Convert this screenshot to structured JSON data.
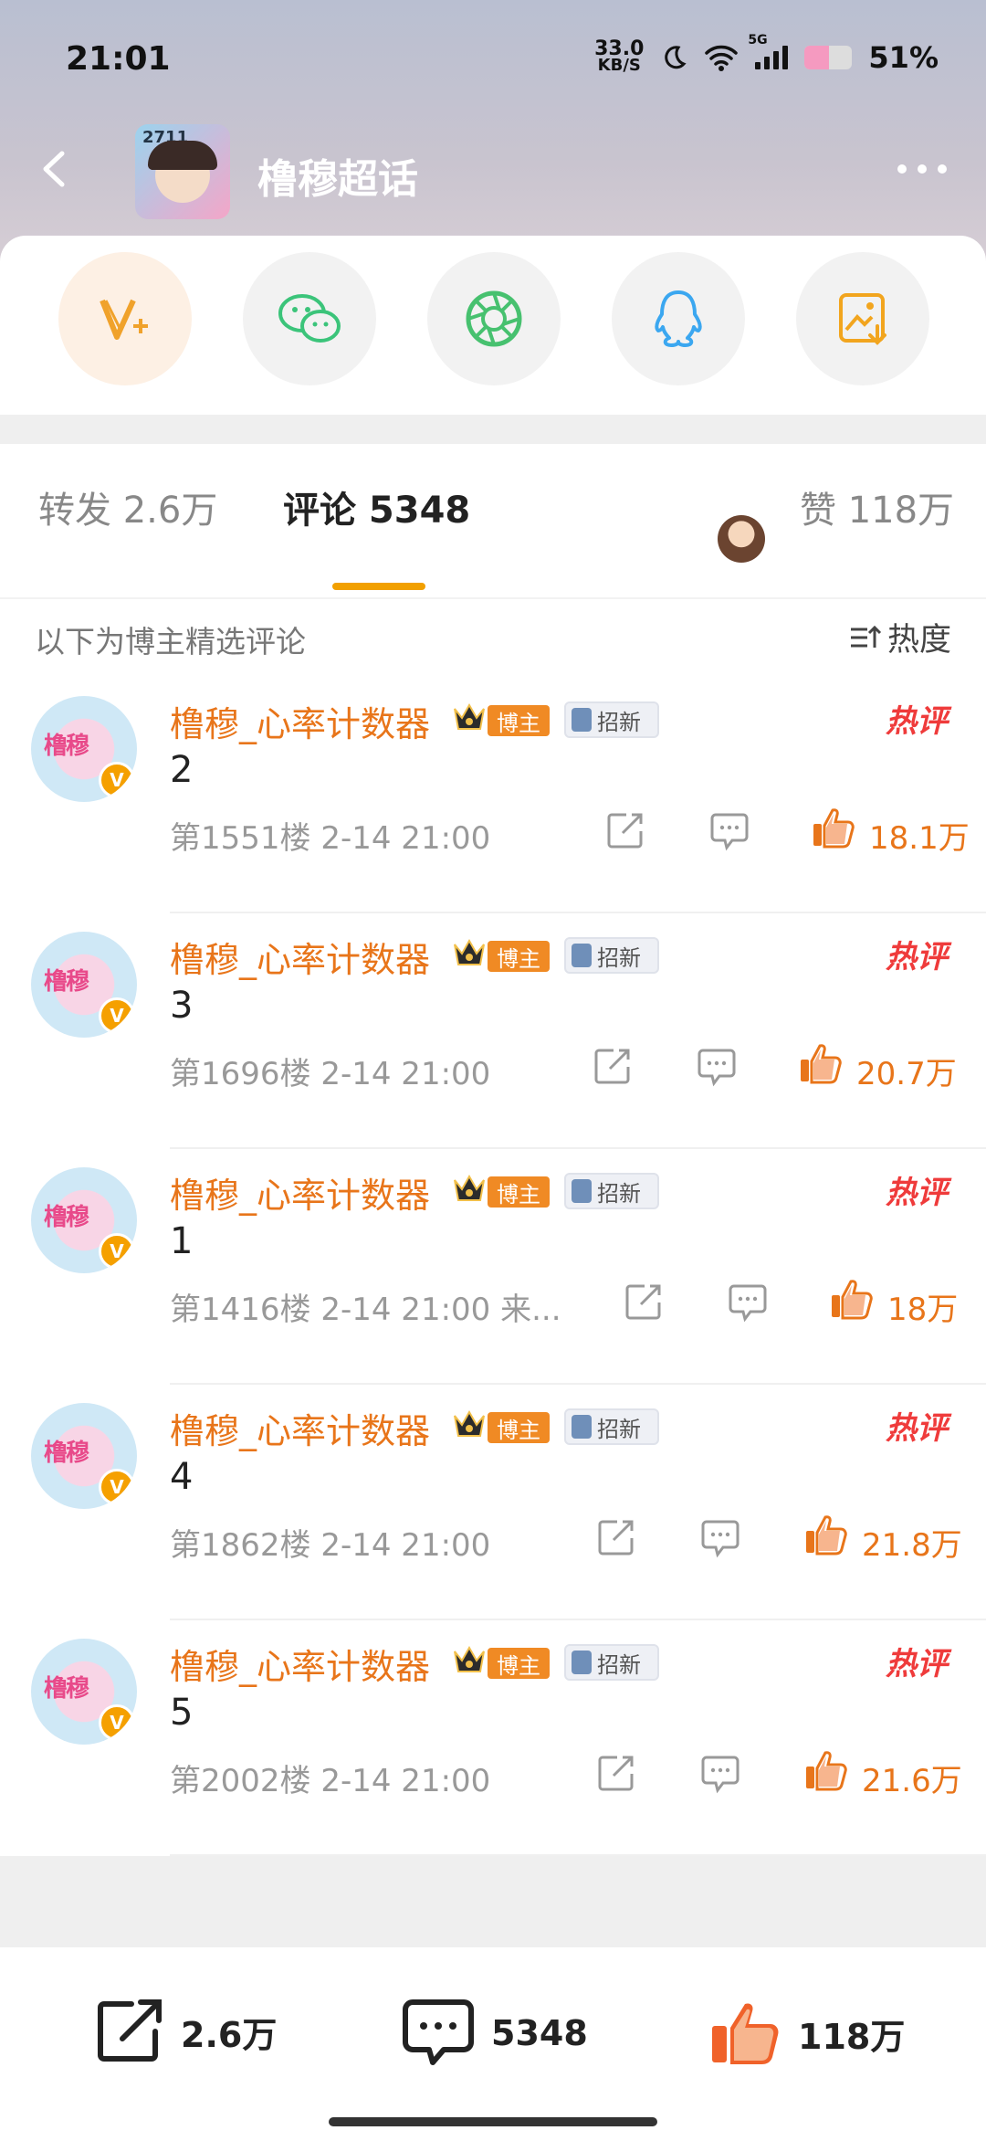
{
  "status_bar": {
    "time": "21:01",
    "net_speed_value": "33.0",
    "net_speed_unit": "KB/S",
    "network": "5G",
    "battery": "51%"
  },
  "nav": {
    "title": "橹穆超话",
    "thumb_text": "2711"
  },
  "share_targets": [
    {
      "name": "weibo-vplus",
      "color": "#f0a22b"
    },
    {
      "name": "wechat",
      "color": "#3bc47a"
    },
    {
      "name": "moments",
      "color": "#47c16f"
    },
    {
      "name": "qq",
      "color": "#3ba7f0"
    },
    {
      "name": "save-image",
      "color": "#f2a51e"
    }
  ],
  "tabs": {
    "repost": "转发 2.6万",
    "comments": "评论 5348",
    "likes": "赞 118万"
  },
  "section": {
    "title": "以下为博主精选评论",
    "sort": "热度"
  },
  "badges": {
    "owner": "博主",
    "recruit": "招新",
    "hot": "热评",
    "avatar_text": "橹穆",
    "verified": "V"
  },
  "comments": [
    {
      "user": "橹穆_心率计数器",
      "text": "2",
      "meta": "第1551楼 2-14 21:00",
      "likes": "18.1万"
    },
    {
      "user": "橹穆_心率计数器",
      "text": "3",
      "meta": "第1696楼 2-14 21:00",
      "likes": "20.7万"
    },
    {
      "user": "橹穆_心率计数器",
      "text": "1",
      "meta": "第1416楼 2-14 21:00  来...",
      "likes": "18万"
    },
    {
      "user": "橹穆_心率计数器",
      "text": "4",
      "meta": "第1862楼 2-14 21:00",
      "likes": "21.8万"
    },
    {
      "user": "橹穆_心率计数器",
      "text": "5",
      "meta": "第2002楼 2-14 21:00",
      "likes": "21.6万"
    }
  ],
  "bottom_bar": {
    "reposts": "2.6万",
    "comments": "5348",
    "likes": "118万"
  },
  "colors": {
    "accent_orange": "#e8751a",
    "tab_underline": "#f2a000",
    "hot_red": "#ef3b3b"
  }
}
